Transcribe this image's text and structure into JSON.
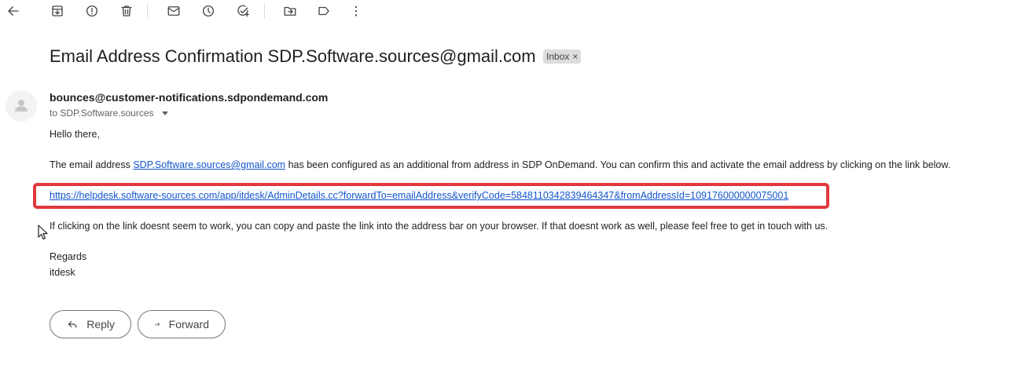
{
  "toolbar": {
    "icons": [
      "back-arrow-icon",
      "archive-icon",
      "report-spam-icon",
      "delete-icon",
      "mark-unread-icon",
      "snooze-icon",
      "add-task-icon",
      "move-to-icon",
      "label-icon",
      "more-options-icon"
    ]
  },
  "email": {
    "subject": "Email Address Confirmation SDP.Software.sources@gmail.com",
    "label": "Inbox",
    "label_close": "×",
    "sender": "bounces@customer-notifications.sdpondemand.com",
    "to": "to SDP.Software.sources",
    "greeting": "Hello there,",
    "para1_prefix": "The email address ",
    "para1_link": "SDP.Software.sources@gmail.com",
    "para1_suffix": " has been configured as an additional from address in SDP OnDemand. You can confirm this and activate the email address by clicking on the link below.",
    "verify_link": "https://helpdesk.software-sources.com/app/itdesk/AdminDetails.cc?forwardTo=emailAddress&verifyCode=5848110342839464347&fromAddressId=109176000000075001",
    "para2": "If clicking on the link doesnt seem to work, you can copy and paste the link into the address bar on your browser. If that doesnt work as well, please feel free to get in touch with us.",
    "regards": "Regards",
    "signature": "itdesk"
  },
  "actions": {
    "reply_label": "Reply",
    "forward_label": "Forward"
  },
  "colors": {
    "link": "#1155cc",
    "highlight_border": "#e0383e",
    "chip_bg": "#dddddd"
  }
}
